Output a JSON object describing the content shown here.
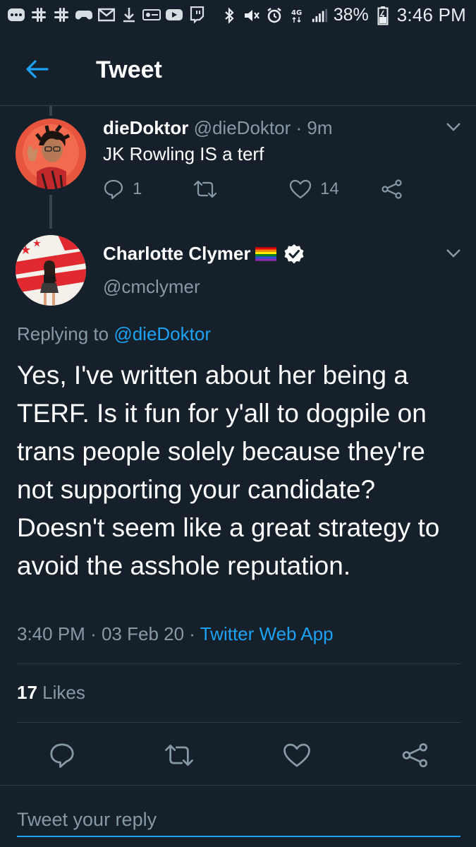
{
  "status_bar": {
    "left_icons": [
      "message-badge-icon",
      "slack-icon",
      "slack-icon",
      "game-controller-icon",
      "gmail-icon",
      "download-icon",
      "key-card-icon",
      "youtube-icon",
      "twitch-icon"
    ],
    "right_icons": [
      "bluetooth-icon",
      "mute-icon",
      "alarm-icon",
      "4g-icon",
      "signal-icon"
    ],
    "battery": "38%",
    "time": "3:46 PM"
  },
  "header": {
    "title": "Tweet",
    "accent": "#1da1f2"
  },
  "reply_tweet": {
    "name": "dieDoktor",
    "handle": "@dieDoktor",
    "separator": "·",
    "age": "9m",
    "text": "JK Rowling IS a terf",
    "reply_count": "1",
    "retweet_count": "",
    "like_count": "14"
  },
  "main_tweet": {
    "name": "Charlotte Clymer",
    "name_badge": "rainbow-flag-icon",
    "verified": "verified-badge-icon",
    "handle": "@cmclymer",
    "replying_prefix": "Replying to",
    "replying_to": "@dieDoktor",
    "text": "Yes, I've written about her being a TERF. Is it fun for y'all to dogpile on trans people solely because they're not supporting your candidate? Doesn't seem like a great strategy to avoid the asshole reputation.",
    "time": "3:40 PM",
    "date": "03 Feb 20",
    "sep": "·",
    "source": "Twitter Web App",
    "likes_count": "17",
    "likes_label": "Likes"
  },
  "reply_box": {
    "placeholder": "Tweet your reply"
  },
  "colors": {
    "background": "#15202b",
    "muted": "#8899a6",
    "link": "#1da1f2",
    "divider": "#2f3d4a"
  }
}
